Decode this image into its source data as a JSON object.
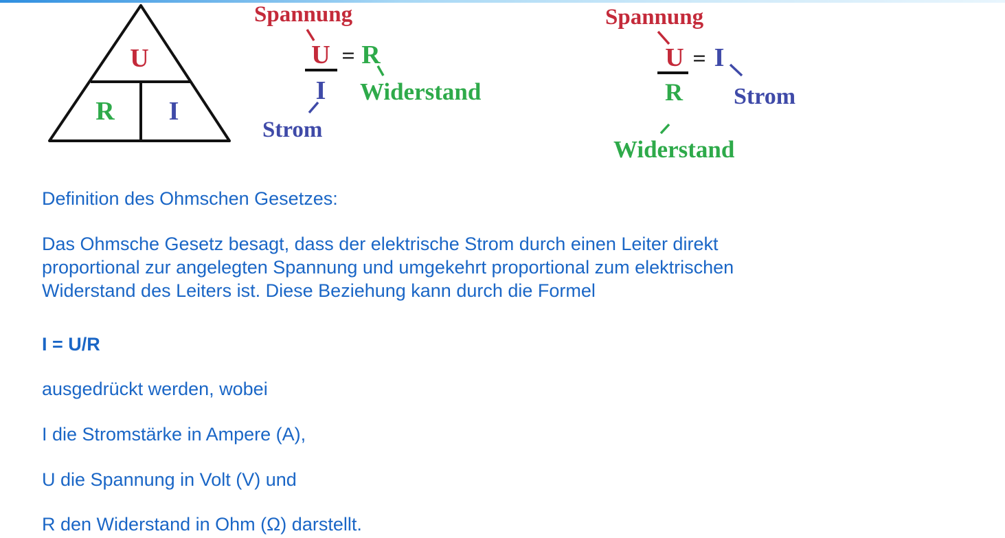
{
  "diagram": {
    "triangle": {
      "top": "U",
      "bottom_left": "R",
      "bottom_right": "I"
    },
    "formula_resistance": {
      "numerator": "U",
      "equals": "=",
      "result": "R",
      "denominator": "I",
      "label_numerator": "Spannung",
      "label_result": "Widerstand",
      "label_denominator": "Strom"
    },
    "formula_current": {
      "numerator": "U",
      "equals": "=",
      "result": "I",
      "denominator": "R",
      "label_numerator": "Spannung",
      "label_result": "Strom",
      "label_denominator": "Widerstand"
    },
    "colors": {
      "voltage": "#c42a3a",
      "resistance": "#2eaa4a",
      "current": "#3f4aa8",
      "text": "#1a66c6"
    }
  },
  "text": {
    "heading": "Definition des Ohmschen Gesetzes:",
    "paragraph": "Das Ohmsche Gesetz besagt, dass der elektrische Strom durch einen Leiter direkt\nproportional zur angelegten Spannung und umgekehrt proportional zum elektrischen\nWiderstand des Leiters ist. Diese Beziehung kann durch die Formel",
    "formula": "I = U/R",
    "after_formula": "ausgedrückt werden, wobei",
    "def_i": "I die Stromstärke in Ampere (A),",
    "def_u": "U die Spannung in Volt (V) und",
    "def_r": "R den Widerstand in Ohm (Ω) darstellt."
  }
}
